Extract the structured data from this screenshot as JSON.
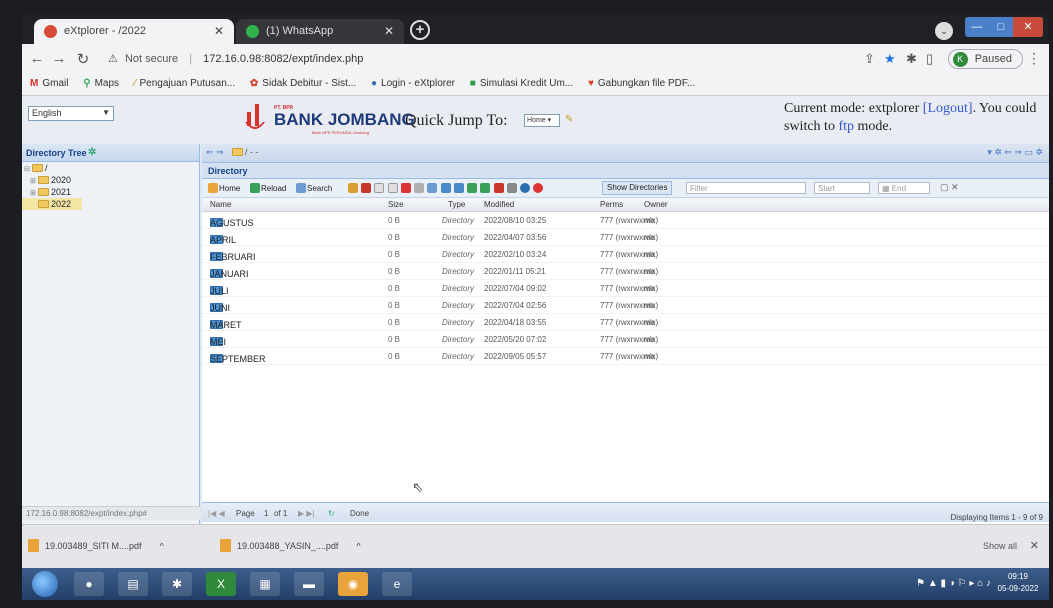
{
  "browser": {
    "tabs": [
      {
        "title": "eXtplorer - /2022",
        "active": true
      },
      {
        "title": "(1) WhatsApp",
        "active": false
      }
    ],
    "address": {
      "security": "Not secure",
      "url": "172.16.0.98:8082/expt/index.php"
    },
    "profile_status": "Paused",
    "profile_initial": "K",
    "bookmarks": [
      {
        "icon": "gmail-icon",
        "label": "Gmail"
      },
      {
        "icon": "maps-icon",
        "label": "Maps"
      },
      {
        "icon": "pengajuan-icon",
        "label": "Pengajuan Putusan..."
      },
      {
        "icon": "sidak-icon",
        "label": "Sidak Debitur - Sist..."
      },
      {
        "icon": "login-icon",
        "label": "Login - eXtplorer"
      },
      {
        "icon": "simulasi-icon",
        "label": "Simulasi Kredit Um..."
      },
      {
        "icon": "gabungkan-icon",
        "label": "Gabungkan file PDF..."
      }
    ]
  },
  "header": {
    "language": "English",
    "logo_pt": "PT. BPR",
    "logo_name": "BANK JOMBANG",
    "logo_tagline": "Bank BPR PERUMDA Jombang",
    "quick_jump_label": "Quick Jump To:",
    "quick_jump_value": "Home",
    "mode_text": "Current mode: extplorer",
    "logout_label": "[Logout]",
    "you_text": ". You could switch to",
    "ftp_label": "ftp",
    "mode_suffix": "mode."
  },
  "tree": {
    "title": "Directory Tree",
    "root": "/",
    "nodes": [
      "2020",
      "2021",
      "2022"
    ],
    "selected": "2022"
  },
  "main": {
    "path": "/ - -",
    "panel_title": "Directory",
    "actions": {
      "home": "Home",
      "reload": "Reload",
      "search": "Search",
      "show_directories": "Show Directories",
      "filter_placeholder": "Filter",
      "start_placeholder": "Start",
      "end_placeholder": "End"
    },
    "columns": {
      "name": "Name",
      "size": "Size",
      "type": "Type",
      "modified": "Modified",
      "perms": "Perms",
      "owner": "Owner"
    },
    "rows": [
      {
        "name": "AGUSTUS",
        "size": "0 B",
        "type": "Directory",
        "modified": "2022/08/10 03:25",
        "perms": "777 (rwxrwxrwx)",
        "owner": "n/a"
      },
      {
        "name": "APRIL",
        "size": "0 B",
        "type": "Directory",
        "modified": "2022/04/07 03:56",
        "perms": "777 (rwxrwxrwx)",
        "owner": "n/a"
      },
      {
        "name": "FEBRUARI",
        "size": "0 B",
        "type": "Directory",
        "modified": "2022/02/10 03:24",
        "perms": "777 (rwxrwxrwx)",
        "owner": "n/a"
      },
      {
        "name": "JANUARI",
        "size": "0 B",
        "type": "Directory",
        "modified": "2022/01/11 05:21",
        "perms": "777 (rwxrwxrwx)",
        "owner": "n/a"
      },
      {
        "name": "JULI",
        "size": "0 B",
        "type": "Directory",
        "modified": "2022/07/04 09:02",
        "perms": "777 (rwxrwxrwx)",
        "owner": "n/a"
      },
      {
        "name": "JUNI",
        "size": "0 B",
        "type": "Directory",
        "modified": "2022/07/04 02:56",
        "perms": "777 (rwxrwxrwx)",
        "owner": "n/a"
      },
      {
        "name": "MARET",
        "size": "0 B",
        "type": "Directory",
        "modified": "2022/04/18 03:55",
        "perms": "777 (rwxrwxrwx)",
        "owner": "n/a"
      },
      {
        "name": "MEI",
        "size": "0 B",
        "type": "Directory",
        "modified": "2022/05/20 07:02",
        "perms": "777 (rwxrwxrwx)",
        "owner": "n/a"
      },
      {
        "name": "SEPTEMBER",
        "size": "0 B",
        "type": "Directory",
        "modified": "2022/09/05 05:57",
        "perms": "777 (rwxrwxrwx)",
        "owner": "n/a"
      }
    ],
    "pager": {
      "page_label": "Page",
      "page": "1",
      "of": "of 1",
      "status": "Done",
      "displaying": "Displaying Items 1 - 9 of 9"
    }
  },
  "status_url": "172.16.0.98:8082/expt/index.php#",
  "downloads": {
    "items": [
      "19.003489_SITI M....pdf",
      "19.003488_YASIN_....pdf"
    ],
    "show_all": "Show all"
  },
  "taskbar": {
    "time": "09:19",
    "date": "05-09-2022"
  },
  "colors": {
    "accent": "#15428b",
    "folder_blue": "#4a93d4",
    "logo_red": "#d8332a",
    "logo_navy": "#1e3a7a",
    "link": "#3358c9"
  }
}
